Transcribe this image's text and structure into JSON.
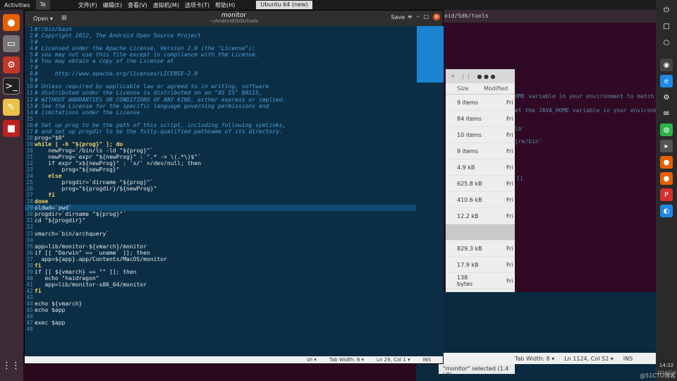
{
  "topbar": {
    "activities": "Activities",
    "tab1": "Te",
    "menus": [
      "文件(F)",
      "编辑(E)",
      "查看(V)",
      "虚拟机(M)",
      "选项卡(T)",
      "帮助(H)"
    ],
    "vm_tab": "Ubuntu 64 (new)"
  },
  "editor": {
    "open_label": "Open ▾",
    "title": "monitor",
    "subtitle": "~/Android/Sdk/tools",
    "save_label": "Save",
    "menu_icon": "≡",
    "status": {
      "lang": "sh ▾",
      "tabwidth": "Tab Width: 8 ▾",
      "position": "Ln 29, Col 1 ▾",
      "mode": "INS"
    },
    "lines": [
      {
        "n": "1",
        "t": "#!/bin/bash",
        "c": "c"
      },
      {
        "n": "2",
        "t": "# Copyright 2012, The Android Open Source Project",
        "c": "c"
      },
      {
        "n": "3",
        "t": "#",
        "c": "c"
      },
      {
        "n": "4",
        "t": "# Licensed under the Apache License, Version 2.0 (the \"License\");",
        "c": "c"
      },
      {
        "n": "5",
        "t": "# you may not use this file except in compliance with the License.",
        "c": "c"
      },
      {
        "n": "6",
        "t": "# You may obtain a copy of the License at",
        "c": "c"
      },
      {
        "n": "7",
        "t": "#",
        "c": "c"
      },
      {
        "n": "8",
        "t": "#     http://www.apache.org/licenses/LICENSE-2.0",
        "c": "c"
      },
      {
        "n": "9",
        "t": "#",
        "c": "c"
      },
      {
        "n": "10",
        "t": "# Unless required by applicable law or agreed to in writing, software",
        "c": "c"
      },
      {
        "n": "11",
        "t": "# distributed under the License is distributed on an \"AS IS\" BASIS,",
        "c": "c"
      },
      {
        "n": "12",
        "t": "# WITHOUT WARRANTIES OR CONDITIONS OF ANY KIND, either express or implied.",
        "c": "c"
      },
      {
        "n": "13",
        "t": "# See the License for the specific language governing permissions and",
        "c": "c"
      },
      {
        "n": "14",
        "t": "# limitations under the License.",
        "c": "c"
      },
      {
        "n": "15",
        "t": "",
        "c": ""
      },
      {
        "n": "16",
        "t": "# Set up prog to be the path of this script, including following symlinks,",
        "c": "c"
      },
      {
        "n": "17",
        "t": "# and set up progdir to be the fully-qualified pathname of its directory.",
        "c": "c"
      },
      {
        "n": "18",
        "t": "prog=\"$0\"",
        "c": ""
      },
      {
        "n": "19",
        "t": "while [ -h \"${prog}\" ]; do",
        "c": "k"
      },
      {
        "n": "20",
        "t": "    newProg=`/bin/ls -ld \"${prog}\"`",
        "c": ""
      },
      {
        "n": "21",
        "t": "    newProg=`expr \"${newProg}\" : \".* -> \\(.*\\)$\"`",
        "c": ""
      },
      {
        "n": "22",
        "t": "    if expr \"x${newProg}\" : 'x/' >/dev/null; then",
        "c": ""
      },
      {
        "n": "23",
        "t": "        prog=\"${newProg}\"",
        "c": ""
      },
      {
        "n": "24",
        "t": "    else",
        "c": "k"
      },
      {
        "n": "25",
        "t": "        progdir=`dirname \"${prog}\"`",
        "c": ""
      },
      {
        "n": "26",
        "t": "        prog=\"${progdir}/${newProg}\"",
        "c": ""
      },
      {
        "n": "27",
        "t": "    fi",
        "c": "k"
      },
      {
        "n": "28",
        "t": "done",
        "c": "k"
      },
      {
        "n": "29",
        "t": "oldwd=`pwd`",
        "c": ""
      },
      {
        "n": "30",
        "t": "progdir=`dirname \"${prog}\"`",
        "c": ""
      },
      {
        "n": "31",
        "t": "cd \"${progdir}\"",
        "c": ""
      },
      {
        "n": "32",
        "t": "",
        "c": ""
      },
      {
        "n": "33",
        "t": "vmarch=`bin/archquery`",
        "c": ""
      },
      {
        "n": "34",
        "t": "",
        "c": ""
      },
      {
        "n": "35",
        "t": "app=lib/monitor-${vmarch}/monitor",
        "c": ""
      },
      {
        "n": "36",
        "t": "if [[ \"Darwin\" == `uname` ]]; then",
        "c": ""
      },
      {
        "n": "37",
        "t": "  app=${app}.app/Contents/MacOS/monitor",
        "c": ""
      },
      {
        "n": "38",
        "t": "fi",
        "c": "k"
      },
      {
        "n": "39",
        "t": "if [[ ${vmarch} == \"\" ]]; then",
        "c": ""
      },
      {
        "n": "40",
        "t": "   echo \"haidragon\"",
        "c": ""
      },
      {
        "n": "41",
        "t": "   app=lib/monitor-x86_64/monitor",
        "c": ""
      },
      {
        "n": "42",
        "t": "fi",
        "c": "k"
      },
      {
        "n": "43",
        "t": "",
        "c": ""
      },
      {
        "n": "44",
        "t": "echo ${vmarch}",
        "c": ""
      },
      {
        "n": "45",
        "t": "echo $app",
        "c": ""
      },
      {
        "n": "46",
        "t": "",
        "c": ""
      },
      {
        "n": "47",
        "t": "exec $app",
        "c": ""
      },
      {
        "n": "48",
        "t": "",
        "c": ""
      }
    ]
  },
  "terminal": {
    "title": "oid/Sdk/tools",
    "lines": [
      "OME variable in your environment to match the",
      "et the JAVA_HOME variable in your environment",
      "lb'",
      "jre/bin'",
      "[]"
    ]
  },
  "filemanager": {
    "columns": [
      "Size",
      "Modified"
    ],
    "rows": [
      {
        "size": "9 items",
        "mod": "Fri"
      },
      {
        "size": "84 items",
        "mod": "Fri"
      },
      {
        "size": "10 items",
        "mod": "Fri"
      },
      {
        "size": "9 items",
        "mod": "Fri"
      },
      {
        "size": "4.9 kB",
        "mod": "Fri"
      },
      {
        "size": "625.8 kB",
        "mod": "Fri"
      },
      {
        "size": "410.6 kB",
        "mod": "Fri"
      },
      {
        "size": "12.2 kB",
        "mod": "Fri"
      },
      {
        "size": "",
        "mod": ""
      },
      {
        "size": "829.3 kB",
        "mod": "Fri"
      },
      {
        "size": "17.9 kB",
        "mod": "Fri"
      },
      {
        "size": "138 bytes",
        "mod": "Fri"
      }
    ],
    "selection": "\"monitor\" selected (1.4 kB)"
  },
  "bg_status": {
    "tab": "Tab Width: 8 ▾",
    "pos": "Ln 1124, Col 52 ▾",
    "mode": "INS"
  },
  "clock": {
    "time": "14:32",
    "date": "2019/7/4"
  },
  "watermark": "@51CTO博客"
}
